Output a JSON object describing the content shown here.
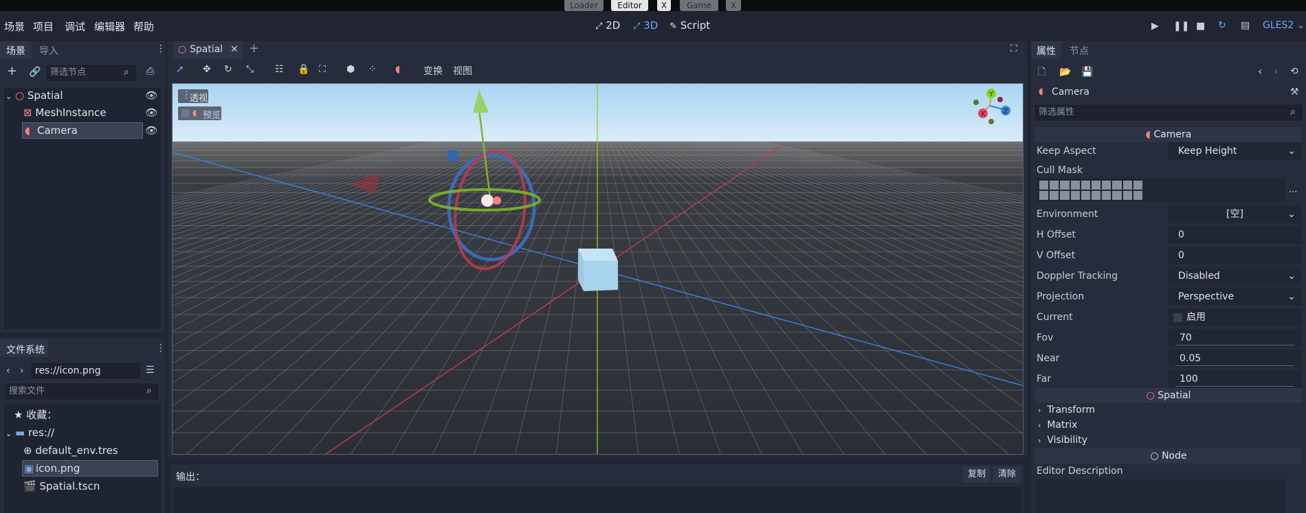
{
  "top_tabs": [
    {
      "label": "Loader",
      "active": false
    },
    {
      "label": "Editor",
      "active": true
    },
    {
      "label": "X",
      "active": false
    },
    {
      "label": "Game",
      "active": false
    },
    {
      "label": "X",
      "active": false
    }
  ],
  "menu": {
    "items": [
      "场景",
      "项目",
      "调试",
      "编辑器",
      "帮助"
    ]
  },
  "modes": {
    "2d": "2D",
    "3d": "3D",
    "script": "Script"
  },
  "renderer": "GLES2",
  "scene_dock": {
    "tabs": [
      "场景",
      "导入"
    ],
    "filter_placeholder": "筛选节点",
    "nodes": [
      {
        "name": "Spatial",
        "icon": "spatial-icon"
      },
      {
        "name": "MeshInstance",
        "icon": "mesh-instance-icon"
      },
      {
        "name": "Camera",
        "icon": "camera-icon",
        "selected": true
      }
    ]
  },
  "filesystem_dock": {
    "title": "文件系统",
    "path": "res://icon.png",
    "search_placeholder": "搜索文件",
    "favorites": "收藏：",
    "root": "res://",
    "files": [
      {
        "name": "default_env.tres",
        "icon": "globe-icon"
      },
      {
        "name": "icon.png",
        "icon": "image-icon",
        "selected": true
      },
      {
        "name": "Spatial.tscn",
        "icon": "scene-icon"
      }
    ]
  },
  "viewport": {
    "tab_label": "Spatial",
    "toolbar": {
      "transform": "变换",
      "view": "视图"
    },
    "perspective_label": "透视",
    "preview_label": "预览",
    "gizmo": {
      "y": "Y",
      "x": "X",
      "z": "Z"
    }
  },
  "output": {
    "label": "输出：",
    "copy": "复制",
    "clear": "清除"
  },
  "inspector": {
    "tabs": [
      "属性",
      "节点"
    ],
    "object_name": "Camera",
    "filter_placeholder": "筛选属性",
    "section_camera": "Camera",
    "properties": [
      {
        "label": "Keep Aspect",
        "value": "Keep Height",
        "kind": "dropdown"
      },
      {
        "label": "Environment",
        "value": "[空]",
        "kind": "dropdown"
      },
      {
        "label": "H Offset",
        "value": "0",
        "kind": "number"
      },
      {
        "label": "V Offset",
        "value": "0",
        "kind": "number"
      },
      {
        "label": "Doppler Tracking",
        "value": "Disabled",
        "kind": "dropdown"
      },
      {
        "label": "Projection",
        "value": "Perspective",
        "kind": "dropdown"
      },
      {
        "label": "Current",
        "value": "启用",
        "kind": "checkbox"
      },
      {
        "label": "Fov",
        "value": "70",
        "kind": "slider"
      },
      {
        "label": "Near",
        "value": "0.05",
        "kind": "slider"
      },
      {
        "label": "Far",
        "value": "100",
        "kind": "slider"
      }
    ],
    "cull_mask_label": "Cull Mask",
    "cull_mask_more": "...",
    "section_spatial": "Spatial",
    "spatial_groups": [
      "Transform",
      "Matrix",
      "Visibility"
    ],
    "section_node": "Node",
    "editor_description": "Editor Description"
  },
  "colors": {
    "accent": "#6ea8ff",
    "panel_bg": "#262c3b",
    "app_bg": "#202531"
  }
}
